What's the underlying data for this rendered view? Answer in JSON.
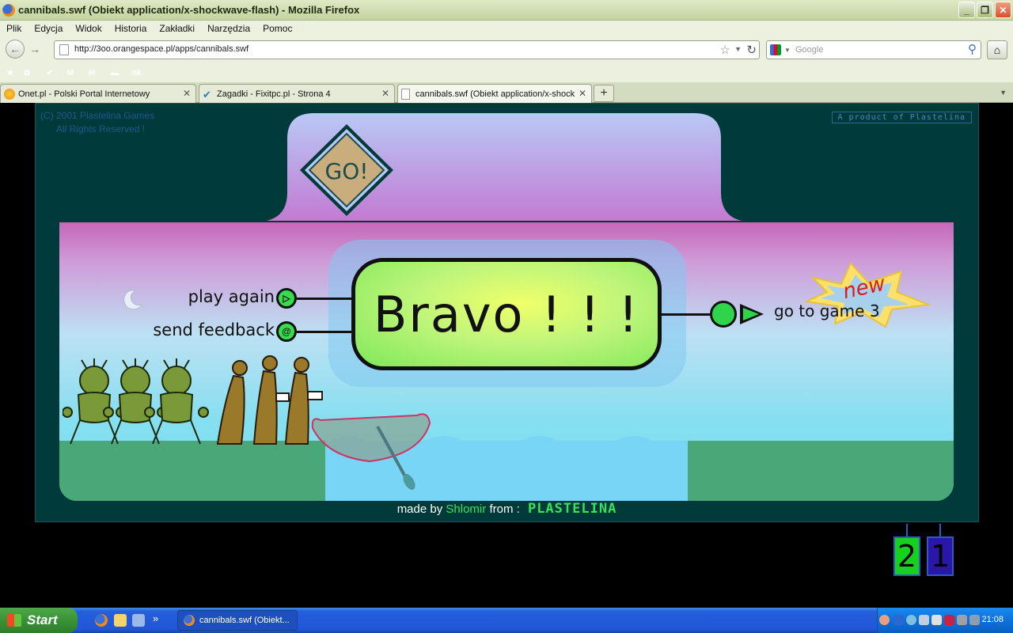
{
  "window": {
    "title": "cannibals.swf (Obiekt application/x-shockwave-flash) - Mozilla Firefox",
    "minimize": "_",
    "maximize": "❐",
    "close": "✕"
  },
  "menu": [
    "Plik",
    "Edycja",
    "Widok",
    "Historia",
    "Zakładki",
    "Narzędzia",
    "Pomoc"
  ],
  "nav": {
    "back": "←",
    "forward": "→",
    "url": "http://3oo.orangespace.pl/apps/cannibals.swf",
    "search_placeholder": "Google",
    "home": "⌂"
  },
  "bookmarks": [
    {
      "icon": "star-bookmark-icon",
      "glyph": "★",
      "color": "#444"
    },
    {
      "icon": "bookmark-icon-2",
      "glyph": "✿",
      "color": "#667"
    },
    {
      "icon": "bookmark-icon-3",
      "glyph": "✔",
      "color": "#2a7ad0"
    },
    {
      "icon": "gmail-icon",
      "glyph": "M",
      "color": "#d93025"
    },
    {
      "icon": "m-icon",
      "glyph": "M",
      "color": "#1565c0"
    },
    {
      "icon": "orange-icon",
      "glyph": "▬",
      "color": "#ff7900"
    },
    {
      "icon": "nk-icon",
      "glyph": "nk",
      "color": "#1f4e8c"
    }
  ],
  "tabs": [
    {
      "label": "Onet.pl - Polski Portal Internetowy",
      "active": false
    },
    {
      "label": "Zagadki - Fixitpc.pl - Strona 4",
      "active": false
    },
    {
      "label": "cannibals.swf (Obiekt application/x-shock...",
      "active": true
    }
  ],
  "newtab": "+",
  "game": {
    "copyright_line1": "(C) 2001 Plastelina Games",
    "copyright_line2": "All Rights Reserved !",
    "product": "A product of Plastelina",
    "go": "GO!",
    "bravo": "Bravo ! ! !",
    "play_again": "play again",
    "send_feedback": "send feedback",
    "play_glyph": "▷",
    "feedback_glyph": "@",
    "goto": "go to game 3",
    "new_badge": "new",
    "madeby_prefix": "made by",
    "madeby_author": "Shlomir",
    "madeby_from": "from :",
    "madeby_brand": "PLASTELINA",
    "levels": [
      {
        "label": "2",
        "color": "#16d21f"
      },
      {
        "label": "1",
        "color": "#2a16a8"
      }
    ]
  },
  "taskbar": {
    "start": "Start",
    "more": "»",
    "task_label": "cannibals.swf (Obiekt...",
    "clock": "21:08"
  }
}
